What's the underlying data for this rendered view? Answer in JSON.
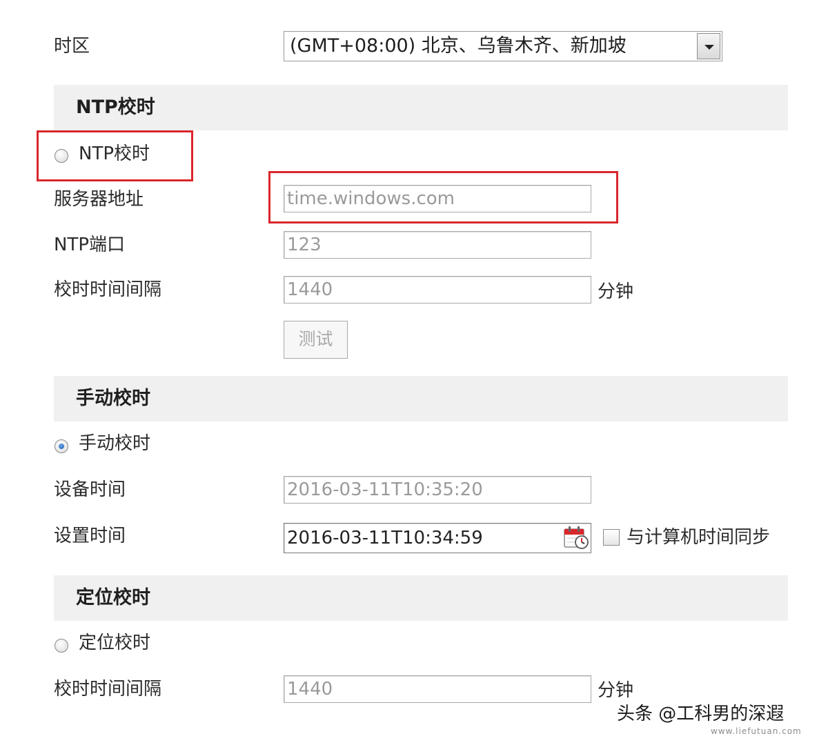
{
  "timezone": {
    "label": "时区",
    "value": "(GMT+08:00) 北京、乌鲁木齐、新加坡"
  },
  "ntp": {
    "section_title": "NTP校时",
    "radio_label": "NTP校时",
    "server_label": "服务器地址",
    "server_value": "time.windows.com",
    "port_label": "NTP端口",
    "port_value": "123",
    "interval_label": "校时时间间隔",
    "interval_value": "1440",
    "interval_unit": "分钟",
    "test_button": "测试"
  },
  "manual": {
    "section_title": "手动校时",
    "radio_label": "手动校时",
    "device_time_label": "设备时间",
    "device_time_value": "2016-03-11T10:35:20",
    "set_time_label": "设置时间",
    "set_time_value": "2016-03-11T10:34:59",
    "sync_label": "与计算机时间同步"
  },
  "gps": {
    "section_title": "定位校时",
    "radio_label": "定位校时",
    "interval_label": "校时时间间隔",
    "interval_value": "1440",
    "interval_unit": "分钟"
  },
  "watermark": {
    "text": "头条 @工科男的深遐",
    "sub": "www.liefutuan.com"
  },
  "colors": {
    "highlight": "#d9262c",
    "section_bg": "#f0f0f0"
  }
}
